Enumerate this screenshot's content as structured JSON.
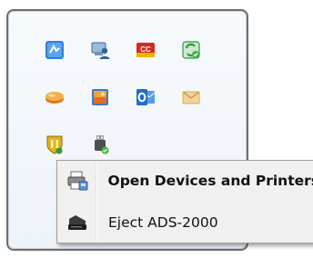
{
  "tray_popup": {
    "icons": [
      {
        "name": "blue-app-icon",
        "color": "#2f7fd6"
      },
      {
        "name": "network-user-icon",
        "color": "#3a6fb0"
      },
      {
        "name": "ccc-red-icon",
        "color": "#d42a1e",
        "text": "CC"
      },
      {
        "name": "green-sync-icon",
        "color": "#2e9a3c"
      },
      {
        "name": "orange-disk-icon",
        "color": "#f0a034"
      },
      {
        "name": "picture-frame-icon",
        "color": "#e58a2e"
      },
      {
        "name": "outlook-icon",
        "color": "#1f6fc9",
        "text": "O"
      },
      {
        "name": "envelope-icon",
        "color": "#e9c27d"
      },
      {
        "name": "yellow-shield-icon",
        "color": "#e4b21a"
      },
      {
        "name": "usb-device-icon",
        "color": "#4e4e4e"
      }
    ]
  },
  "context_menu": {
    "items": [
      {
        "label": "Open Devices and Printers",
        "icon": "devices-printers-icon",
        "default": true
      },
      {
        "label": "Eject ADS-2000",
        "icon": "scanner-icon",
        "default": false
      }
    ]
  }
}
